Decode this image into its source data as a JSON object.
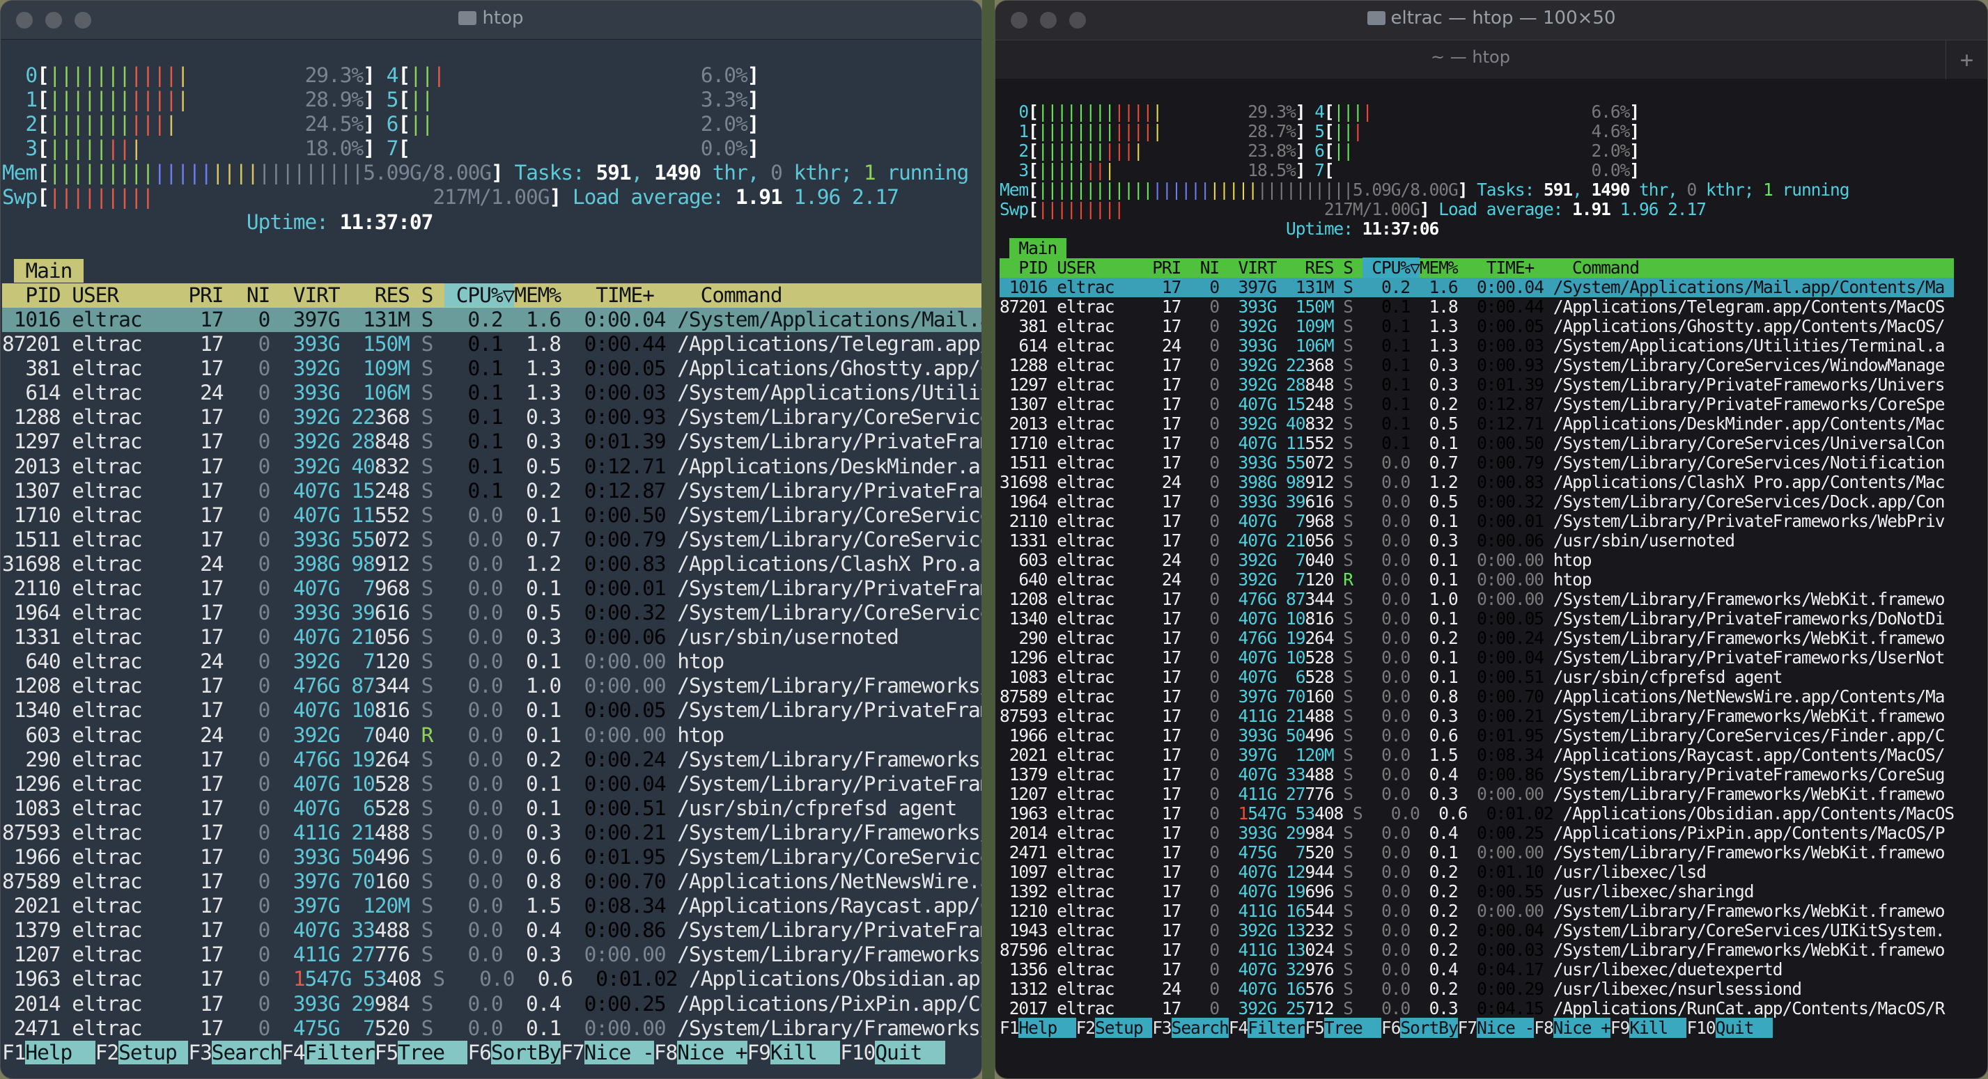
{
  "left": {
    "title": "htop",
    "cpus": [
      {
        "id": "0",
        "bars": "||||||||||||",
        "pct": "29.3%"
      },
      {
        "id": "1",
        "bars": "||||||||||||",
        "pct": "28.9%"
      },
      {
        "id": "2",
        "bars": "|||||||||||",
        "pct": "24.5%"
      },
      {
        "id": "3",
        "bars": "||||||||",
        "pct": "18.0%"
      },
      {
        "id": "4",
        "bars": "|||",
        "pct": "6.0%"
      },
      {
        "id": "5",
        "bars": "||",
        "pct": "3.3%"
      },
      {
        "id": "6",
        "bars": "||",
        "pct": "2.0%"
      },
      {
        "id": "7",
        "bars": "",
        "pct": "0.0%"
      }
    ],
    "mem": {
      "label": "Mem",
      "used_bars": "||||||||||||||||||",
      "cache_bars": "|||||||||",
      "value": "5.09G/8.00G"
    },
    "swp": {
      "label": "Swp",
      "bars": "|||||||||",
      "value": "217M/1.00G"
    },
    "tasks": {
      "label": "Tasks: ",
      "count": "591",
      "thr": "1490",
      "thr_label": " thr, ",
      "kthr": "0",
      "kthr_label": " kthr; ",
      "running": "1",
      "running_label": " running"
    },
    "load": {
      "label": "Load average: ",
      "v1": "1.91",
      "v2": "1.96",
      "v3": "2.17"
    },
    "uptime": {
      "label": "Uptime: ",
      "value": "11:37:07"
    },
    "tab": "Main",
    "header": {
      "pid": "PID",
      "user": "USER",
      "pri": "PRI",
      "ni": "NI",
      "virt": "VIRT",
      "res": "RES",
      "s": "S",
      "cpu": "CPU%▽",
      "mem": "MEM%",
      "time": "TIME+",
      "cmd": "Command"
    },
    "rows": [
      [
        "1016",
        "eltrac",
        "17",
        "0",
        "397G",
        "131M",
        "S",
        "0.2",
        "1.6",
        "0:00.04",
        "/System/Applications/Mail.ap"
      ],
      [
        "87201",
        "eltrac",
        "17",
        "0",
        "393G",
        "150M",
        "S",
        "0.1",
        "1.8",
        "0:00.44",
        "/Applications/Telegram.app/C"
      ],
      [
        "381",
        "eltrac",
        "17",
        "0",
        "392G",
        "109M",
        "S",
        "0.1",
        "1.3",
        "0:00.05",
        "/Applications/Ghostty.app/Co"
      ],
      [
        "614",
        "eltrac",
        "24",
        "0",
        "393G",
        "106M",
        "S",
        "0.1",
        "1.3",
        "0:00.03",
        "/System/Applications/Utiliti"
      ],
      [
        "1288",
        "eltrac",
        "17",
        "0",
        "392G",
        "22368",
        "S",
        "0.1",
        "0.3",
        "0:00.93",
        "/System/Library/CoreServices"
      ],
      [
        "1297",
        "eltrac",
        "17",
        "0",
        "392G",
        "28848",
        "S",
        "0.1",
        "0.3",
        "0:01.39",
        "/System/Library/PrivateFrame"
      ],
      [
        "2013",
        "eltrac",
        "17",
        "0",
        "392G",
        "40832",
        "S",
        "0.1",
        "0.5",
        "0:12.71",
        "/Applications/DeskMinder.app"
      ],
      [
        "1307",
        "eltrac",
        "17",
        "0",
        "407G",
        "15248",
        "S",
        "0.1",
        "0.2",
        "0:12.87",
        "/System/Library/PrivateFrame"
      ],
      [
        "1710",
        "eltrac",
        "17",
        "0",
        "407G",
        "11552",
        "S",
        "0.0",
        "0.1",
        "0:00.50",
        "/System/Library/CoreServices"
      ],
      [
        "1511",
        "eltrac",
        "17",
        "0",
        "393G",
        "55072",
        "S",
        "0.0",
        "0.7",
        "0:00.79",
        "/System/Library/CoreServices"
      ],
      [
        "31698",
        "eltrac",
        "24",
        "0",
        "398G",
        "98912",
        "S",
        "0.0",
        "1.2",
        "0:00.83",
        "/Applications/ClashX Pro.app"
      ],
      [
        "2110",
        "eltrac",
        "17",
        "0",
        "407G",
        "7968",
        "S",
        "0.0",
        "0.1",
        "0:00.01",
        "/System/Library/PrivateFrame"
      ],
      [
        "1964",
        "eltrac",
        "17",
        "0",
        "393G",
        "39616",
        "S",
        "0.0",
        "0.5",
        "0:00.32",
        "/System/Library/CoreServices"
      ],
      [
        "1331",
        "eltrac",
        "17",
        "0",
        "407G",
        "21056",
        "S",
        "0.0",
        "0.3",
        "0:00.06",
        "/usr/sbin/usernoted"
      ],
      [
        "640",
        "eltrac",
        "24",
        "0",
        "392G",
        "7120",
        "S",
        "0.0",
        "0.1",
        "0:00.00",
        "htop"
      ],
      [
        "1208",
        "eltrac",
        "17",
        "0",
        "476G",
        "87344",
        "S",
        "0.0",
        "1.0",
        "0:00.00",
        "/System/Library/Frameworks/W"
      ],
      [
        "1340",
        "eltrac",
        "17",
        "0",
        "407G",
        "10816",
        "S",
        "0.0",
        "0.1",
        "0:00.05",
        "/System/Library/PrivateFrame"
      ],
      [
        "603",
        "eltrac",
        "24",
        "0",
        "392G",
        "7040",
        "R",
        "0.0",
        "0.1",
        "0:00.00",
        "htop"
      ],
      [
        "290",
        "eltrac",
        "17",
        "0",
        "476G",
        "19264",
        "S",
        "0.0",
        "0.2",
        "0:00.24",
        "/System/Library/Frameworks/W"
      ],
      [
        "1296",
        "eltrac",
        "17",
        "0",
        "407G",
        "10528",
        "S",
        "0.0",
        "0.1",
        "0:00.04",
        "/System/Library/PrivateFrame"
      ],
      [
        "1083",
        "eltrac",
        "17",
        "0",
        "407G",
        "6528",
        "S",
        "0.0",
        "0.1",
        "0:00.51",
        "/usr/sbin/cfprefsd agent"
      ],
      [
        "87593",
        "eltrac",
        "17",
        "0",
        "411G",
        "21488",
        "S",
        "0.0",
        "0.3",
        "0:00.21",
        "/System/Library/Frameworks/W"
      ],
      [
        "1966",
        "eltrac",
        "17",
        "0",
        "393G",
        "50496",
        "S",
        "0.0",
        "0.6",
        "0:01.95",
        "/System/Library/CoreServices"
      ],
      [
        "87589",
        "eltrac",
        "17",
        "0",
        "397G",
        "70160",
        "S",
        "0.0",
        "0.8",
        "0:00.70",
        "/Applications/NetNewsWire.ap"
      ],
      [
        "2021",
        "eltrac",
        "17",
        "0",
        "397G",
        "120M",
        "S",
        "0.0",
        "1.5",
        "0:08.34",
        "/Applications/Raycast.app/Co"
      ],
      [
        "1379",
        "eltrac",
        "17",
        "0",
        "407G",
        "33488",
        "S",
        "0.0",
        "0.4",
        "0:00.86",
        "/System/Library/PrivateFrame"
      ],
      [
        "1207",
        "eltrac",
        "17",
        "0",
        "411G",
        "27776",
        "S",
        "0.0",
        "0.3",
        "0:00.00",
        "/System/Library/Frameworks/W"
      ],
      [
        "1963",
        "eltrac",
        "17",
        "0",
        "1547G",
        "53408",
        "S",
        "0.0",
        "0.6",
        "0:01.02",
        "/Applications/Obsidian.app/C"
      ],
      [
        "2014",
        "eltrac",
        "17",
        "0",
        "393G",
        "29984",
        "S",
        "0.0",
        "0.4",
        "0:00.25",
        "/Applications/PixPin.app/Con"
      ],
      [
        "2471",
        "eltrac",
        "17",
        "0",
        "475G",
        "7520",
        "S",
        "0.0",
        "0.1",
        "0:00.00",
        "/System/Library/Frameworks/W"
      ]
    ],
    "fkeys": [
      [
        "F1",
        "Help  "
      ],
      [
        "F2",
        "Setup "
      ],
      [
        "F3",
        "Search"
      ],
      [
        "F4",
        "Filter"
      ],
      [
        "F5",
        "Tree  "
      ],
      [
        "F6",
        "SortBy"
      ],
      [
        "F7",
        "Nice -"
      ],
      [
        "F8",
        "Nice +"
      ],
      [
        "F9",
        "Kill  "
      ],
      [
        "F10",
        "Quit  "
      ]
    ]
  },
  "right": {
    "title": "eltrac — htop — 100×50",
    "tab": "~ — htop",
    "tab_add": "+",
    "cpus": [
      {
        "id": "0",
        "bars": "|||||||||||||",
        "pct": "29.3%"
      },
      {
        "id": "1",
        "bars": "|||||||||||||",
        "pct": "28.7%"
      },
      {
        "id": "2",
        "bars": "|||||||||||",
        "pct": "23.8%"
      },
      {
        "id": "3",
        "bars": "||||||||",
        "pct": "18.5%"
      },
      {
        "id": "4",
        "bars": "||||",
        "pct": "6.6%"
      },
      {
        "id": "5",
        "bars": "|||",
        "pct": "4.6%"
      },
      {
        "id": "6",
        "bars": "||",
        "pct": "2.0%"
      },
      {
        "id": "7",
        "bars": "",
        "pct": "0.0%"
      }
    ],
    "mem": {
      "label": "Mem",
      "used_bars": "|||||||||||||||||||||||",
      "cache_bars": "||||||||||",
      "value": "5.09G/8.00G"
    },
    "swp": {
      "label": "Swp",
      "bars": "|||||||||",
      "value": "217M/1.00G"
    },
    "tasks": {
      "label": "Tasks: ",
      "count": "591",
      "thr": "1490",
      "thr_label": " thr, ",
      "kthr": "0",
      "kthr_label": " kthr; ",
      "running": "1",
      "running_label": " running"
    },
    "load": {
      "label": "Load average: ",
      "v1": "1.91",
      "v2": "1.96",
      "v3": "2.17"
    },
    "uptime": {
      "label": "Uptime: ",
      "value": "11:37:06"
    },
    "header": {
      "pid": "PID",
      "user": "USER",
      "pri": "PRI",
      "ni": "NI",
      "virt": "VIRT",
      "res": "RES",
      "s": "S",
      "cpu": "CPU%▽",
      "mem": "MEM%",
      "time": "TIME+",
      "cmd": "Command"
    },
    "rows": [
      [
        "1016",
        "eltrac",
        "17",
        "0",
        "397G",
        "131M",
        "S",
        "0.2",
        "1.6",
        "0:00.04",
        "/System/Applications/Mail.app/Contents/Ma"
      ],
      [
        "87201",
        "eltrac",
        "17",
        "0",
        "393G",
        "150M",
        "S",
        "0.1",
        "1.8",
        "0:00.44",
        "/Applications/Telegram.app/Contents/MacOS"
      ],
      [
        "381",
        "eltrac",
        "17",
        "0",
        "392G",
        "109M",
        "S",
        "0.1",
        "1.3",
        "0:00.05",
        "/Applications/Ghostty.app/Contents/MacOS/"
      ],
      [
        "614",
        "eltrac",
        "24",
        "0",
        "393G",
        "106M",
        "S",
        "0.1",
        "1.3",
        "0:00.03",
        "/System/Applications/Utilities/Terminal.a"
      ],
      [
        "1288",
        "eltrac",
        "17",
        "0",
        "392G",
        "22368",
        "S",
        "0.1",
        "0.3",
        "0:00.93",
        "/System/Library/CoreServices/WindowManage"
      ],
      [
        "1297",
        "eltrac",
        "17",
        "0",
        "392G",
        "28848",
        "S",
        "0.1",
        "0.3",
        "0:01.39",
        "/System/Library/PrivateFrameworks/Univers"
      ],
      [
        "1307",
        "eltrac",
        "17",
        "0",
        "407G",
        "15248",
        "S",
        "0.1",
        "0.2",
        "0:12.87",
        "/System/Library/PrivateFrameworks/CoreSpe"
      ],
      [
        "2013",
        "eltrac",
        "17",
        "0",
        "392G",
        "40832",
        "S",
        "0.1",
        "0.5",
        "0:12.71",
        "/Applications/DeskMinder.app/Contents/Mac"
      ],
      [
        "1710",
        "eltrac",
        "17",
        "0",
        "407G",
        "11552",
        "S",
        "0.1",
        "0.1",
        "0:00.50",
        "/System/Library/CoreServices/UniversalCon"
      ],
      [
        "1511",
        "eltrac",
        "17",
        "0",
        "393G",
        "55072",
        "S",
        "0.0",
        "0.7",
        "0:00.79",
        "/System/Library/CoreServices/Notification"
      ],
      [
        "31698",
        "eltrac",
        "24",
        "0",
        "398G",
        "98912",
        "S",
        "0.0",
        "1.2",
        "0:00.83",
        "/Applications/ClashX Pro.app/Contents/Mac"
      ],
      [
        "1964",
        "eltrac",
        "17",
        "0",
        "393G",
        "39616",
        "S",
        "0.0",
        "0.5",
        "0:00.32",
        "/System/Library/CoreServices/Dock.app/Con"
      ],
      [
        "2110",
        "eltrac",
        "17",
        "0",
        "407G",
        "7968",
        "S",
        "0.0",
        "0.1",
        "0:00.01",
        "/System/Library/PrivateFrameworks/WebPriv"
      ],
      [
        "1331",
        "eltrac",
        "17",
        "0",
        "407G",
        "21056",
        "S",
        "0.0",
        "0.3",
        "0:00.06",
        "/usr/sbin/usernoted"
      ],
      [
        "603",
        "eltrac",
        "24",
        "0",
        "392G",
        "7040",
        "S",
        "0.0",
        "0.1",
        "0:00.00",
        "htop"
      ],
      [
        "640",
        "eltrac",
        "24",
        "0",
        "392G",
        "7120",
        "R",
        "0.0",
        "0.1",
        "0:00.00",
        "htop"
      ],
      [
        "1208",
        "eltrac",
        "17",
        "0",
        "476G",
        "87344",
        "S",
        "0.0",
        "1.0",
        "0:00.00",
        "/System/Library/Frameworks/WebKit.framewo"
      ],
      [
        "1340",
        "eltrac",
        "17",
        "0",
        "407G",
        "10816",
        "S",
        "0.0",
        "0.1",
        "0:00.05",
        "/System/Library/PrivateFrameworks/DoNotDi"
      ],
      [
        "290",
        "eltrac",
        "17",
        "0",
        "476G",
        "19264",
        "S",
        "0.0",
        "0.2",
        "0:00.24",
        "/System/Library/Frameworks/WebKit.framewo"
      ],
      [
        "1296",
        "eltrac",
        "17",
        "0",
        "407G",
        "10528",
        "S",
        "0.0",
        "0.1",
        "0:00.04",
        "/System/Library/PrivateFrameworks/UserNot"
      ],
      [
        "1083",
        "eltrac",
        "17",
        "0",
        "407G",
        "6528",
        "S",
        "0.0",
        "0.1",
        "0:00.51",
        "/usr/sbin/cfprefsd agent"
      ],
      [
        "87589",
        "eltrac",
        "17",
        "0",
        "397G",
        "70160",
        "S",
        "0.0",
        "0.8",
        "0:00.70",
        "/Applications/NetNewsWire.app/Contents/Ma"
      ],
      [
        "87593",
        "eltrac",
        "17",
        "0",
        "411G",
        "21488",
        "S",
        "0.0",
        "0.3",
        "0:00.21",
        "/System/Library/Frameworks/WebKit.framewo"
      ],
      [
        "1966",
        "eltrac",
        "17",
        "0",
        "393G",
        "50496",
        "S",
        "0.0",
        "0.6",
        "0:01.95",
        "/System/Library/CoreServices/Finder.app/C"
      ],
      [
        "2021",
        "eltrac",
        "17",
        "0",
        "397G",
        "120M",
        "S",
        "0.0",
        "1.5",
        "0:08.34",
        "/Applications/Raycast.app/Contents/MacOS/"
      ],
      [
        "1379",
        "eltrac",
        "17",
        "0",
        "407G",
        "33488",
        "S",
        "0.0",
        "0.4",
        "0:00.86",
        "/System/Library/PrivateFrameworks/CoreSug"
      ],
      [
        "1207",
        "eltrac",
        "17",
        "0",
        "411G",
        "27776",
        "S",
        "0.0",
        "0.3",
        "0:00.00",
        "/System/Library/Frameworks/WebKit.framewo"
      ],
      [
        "1963",
        "eltrac",
        "17",
        "0",
        "1547G",
        "53408",
        "S",
        "0.0",
        "0.6",
        "0:01.02",
        "/Applications/Obsidian.app/Contents/MacOS"
      ],
      [
        "2014",
        "eltrac",
        "17",
        "0",
        "393G",
        "29984",
        "S",
        "0.0",
        "0.4",
        "0:00.25",
        "/Applications/PixPin.app/Contents/MacOS/P"
      ],
      [
        "2471",
        "eltrac",
        "17",
        "0",
        "475G",
        "7520",
        "S",
        "0.0",
        "0.1",
        "0:00.00",
        "/System/Library/Frameworks/WebKit.framewo"
      ],
      [
        "1097",
        "eltrac",
        "17",
        "0",
        "407G",
        "12944",
        "S",
        "0.0",
        "0.2",
        "0:01.10",
        "/usr/libexec/lsd"
      ],
      [
        "1392",
        "eltrac",
        "17",
        "0",
        "407G",
        "19696",
        "S",
        "0.0",
        "0.2",
        "0:00.55",
        "/usr/libexec/sharingd"
      ],
      [
        "1210",
        "eltrac",
        "17",
        "0",
        "411G",
        "16544",
        "S",
        "0.0",
        "0.2",
        "0:00.00",
        "/System/Library/Frameworks/WebKit.framewo"
      ],
      [
        "1943",
        "eltrac",
        "17",
        "0",
        "392G",
        "13232",
        "S",
        "0.0",
        "0.2",
        "0:00.04",
        "/System/Library/CoreServices/UIKitSystem."
      ],
      [
        "87596",
        "eltrac",
        "17",
        "0",
        "411G",
        "13024",
        "S",
        "0.0",
        "0.2",
        "0:00.03",
        "/System/Library/Frameworks/WebKit.framewo"
      ],
      [
        "1356",
        "eltrac",
        "17",
        "0",
        "407G",
        "32976",
        "S",
        "0.0",
        "0.4",
        "0:04.17",
        "/usr/libexec/duetexpertd"
      ],
      [
        "1312",
        "eltrac",
        "24",
        "0",
        "407G",
        "16576",
        "S",
        "0.0",
        "0.2",
        "0:00.29",
        "/usr/libexec/nsurlsessiond"
      ],
      [
        "2017",
        "eltrac",
        "17",
        "0",
        "392G",
        "25712",
        "S",
        "0.0",
        "0.3",
        "0:04.15",
        "/Applications/RunCat.app/Contents/MacOS/R"
      ]
    ],
    "fkeys": [
      [
        "F1",
        "Help  "
      ],
      [
        "F2",
        "Setup "
      ],
      [
        "F3",
        "Search"
      ],
      [
        "F4",
        "Filter"
      ],
      [
        "F5",
        "Tree  "
      ],
      [
        "F6",
        "SortBy"
      ],
      [
        "F7",
        "Nice -"
      ],
      [
        "F8",
        "Nice +"
      ],
      [
        "F9",
        "Kill  "
      ],
      [
        "F10",
        "Quit  "
      ]
    ]
  }
}
